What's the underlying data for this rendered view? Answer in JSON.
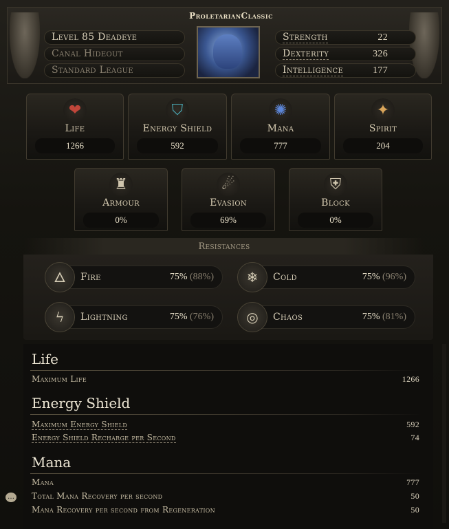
{
  "character": {
    "name": "ProletarianClassic",
    "level_class": "Level 85 Deadeye",
    "location": "Canal Hideout",
    "league": "Standard League"
  },
  "attributes": [
    {
      "label": "Strength",
      "value": "22"
    },
    {
      "label": "Dexterity",
      "value": "326"
    },
    {
      "label": "Intelligence",
      "value": "177"
    }
  ],
  "primary": [
    {
      "label": "Life",
      "value": "1266",
      "icon": "heart-icon",
      "color": "#c0463a"
    },
    {
      "label": "Energy Shield",
      "value": "592",
      "icon": "shield-energy-icon",
      "color": "#49a9b5"
    },
    {
      "label": "Mana",
      "value": "777",
      "icon": "mana-icon",
      "color": "#5c86d9"
    },
    {
      "label": "Spirit",
      "value": "204",
      "icon": "spirit-icon",
      "color": "#d9a55a"
    }
  ],
  "defence": [
    {
      "label": "Armour",
      "value": "0%",
      "icon": "armour-icon"
    },
    {
      "label": "Evasion",
      "value": "69%",
      "icon": "evasion-icon"
    },
    {
      "label": "Block",
      "value": "0%",
      "icon": "block-icon"
    }
  ],
  "resistances": {
    "title": "Resistances",
    "items": [
      {
        "label": "Fire",
        "value": "75%",
        "max": "(88%)",
        "icon": "fire-icon"
      },
      {
        "label": "Cold",
        "value": "75%",
        "max": "(96%)",
        "icon": "cold-icon"
      },
      {
        "label": "Lightning",
        "value": "75%",
        "max": "(76%)",
        "icon": "lightning-icon"
      },
      {
        "label": "Chaos",
        "value": "75%",
        "max": "(81%)",
        "icon": "chaos-icon"
      }
    ]
  },
  "details": {
    "life": {
      "title": "Life",
      "rows": [
        {
          "label": "Maximum Life",
          "value": "1266"
        }
      ]
    },
    "energy_shield": {
      "title": "Energy Shield",
      "rows": [
        {
          "label": "Maximum Energy Shield",
          "value": "592"
        },
        {
          "label": "Energy Shield Recharge per Second",
          "value": "74"
        }
      ]
    },
    "mana": {
      "title": "Mana",
      "rows": [
        {
          "label": "Mana",
          "value": "777"
        },
        {
          "label": "Total Mana Recovery per second",
          "value": "50"
        },
        {
          "label": "Mana Recovery per second from Regeneration",
          "value": "50"
        }
      ]
    }
  }
}
